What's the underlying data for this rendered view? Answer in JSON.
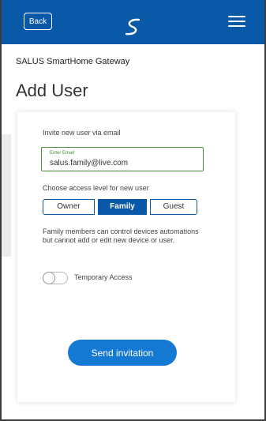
{
  "header": {
    "back_label": "Back",
    "logo_icon": "salus-logo-icon",
    "menu_icon": "hamburger-menu-icon",
    "color": "#0a58a8"
  },
  "page": {
    "gateway_name": "SALUS SmartHome Gateway",
    "title": "Add User"
  },
  "form": {
    "invite_label": "Invite new user via email",
    "email_placeholder": "Enter Email",
    "email_value": "salus.family@live.com",
    "access_label": "Choose access level for new user",
    "access_options": [
      "Owner",
      "Family",
      "Guest"
    ],
    "selected_access": "Family",
    "description": "Family members can control devices automations but cannot add or edit new device or user.",
    "temporary_access_label": "Temporary Access",
    "temporary_access_on": false,
    "send_label": "Send invitation"
  }
}
